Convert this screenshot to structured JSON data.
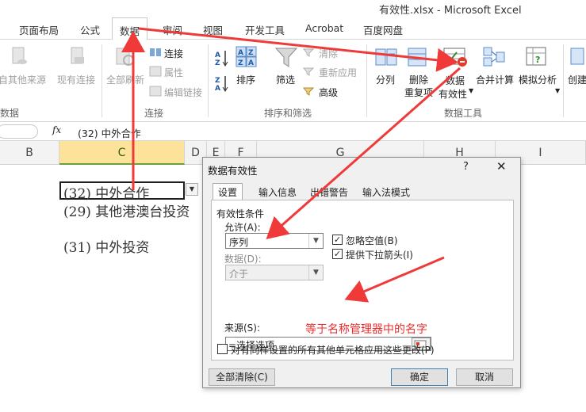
{
  "window": {
    "title": "有效性.xlsx  -  Microsoft Excel"
  },
  "ribbon_tabs": [
    "页面布局",
    "公式",
    "数据",
    "审阅",
    "视图",
    "开发工具",
    "Acrobat",
    "百度网盘"
  ],
  "active_tab": "数据",
  "ribbon": {
    "get_external": {
      "from_other": "自其他来源",
      "existing": "现有连接",
      "group": "数据"
    },
    "connections": {
      "refresh_all": "全部刷新",
      "connections": "连接",
      "properties": "属性",
      "edit_links": "编辑链接",
      "group": "连接"
    },
    "sort_filter": {
      "sort": "排序",
      "filter": "筛选",
      "clear": "清除",
      "reapply": "重新应用",
      "advanced": "高级",
      "group": "排序和筛选"
    },
    "data_tools": {
      "split": "分列",
      "remove_dup_1": "删除",
      "remove_dup_2": "重复项",
      "validation_1": "数据",
      "validation_2": "有效性",
      "consolidate": "合并计算",
      "whatif": "模拟分析",
      "group": "数据工具"
    },
    "outline": {
      "create": "创建"
    }
  },
  "formula_bar": {
    "fx": "fx",
    "value": "(32) 中外合作"
  },
  "columns": [
    "B",
    "C",
    "D",
    "E",
    "F",
    "G",
    "H",
    "I"
  ],
  "selected_column": "C",
  "cells": {
    "c1": "(32) 中外合作",
    "c2": "(29) 其他港澳台投资",
    "c4": "(31) 中外投资"
  },
  "dialog": {
    "title": "数据有效性",
    "help": "?",
    "close": "✕",
    "tabs": [
      "设置",
      "输入信息",
      "出错警告",
      "输入法模式"
    ],
    "active_tab": "设置",
    "section_title": "有效性条件",
    "allow_label": "允许(A):",
    "allow_value": "序列",
    "ignore_blank": "忽略空值(B)",
    "ignore_blank_checked": true,
    "dropdown_label": "提供下拉箭头(I)",
    "dropdown_checked": true,
    "data_label": "数据(D):",
    "data_value": "介于",
    "source_label": "来源(S):",
    "source_value": "=选择选项",
    "apply_all": "对有同样设置的所有其他单元格应用这些更改(P)",
    "apply_all_checked": false,
    "clear_all": "全部清除(C)",
    "ok": "确定",
    "cancel": "取消"
  },
  "annotation": "等于名称管理器中的名字",
  "colors": {
    "arrow": "#f03a3a",
    "selected_col": "#fde29a",
    "note": "#ee2b2b"
  }
}
